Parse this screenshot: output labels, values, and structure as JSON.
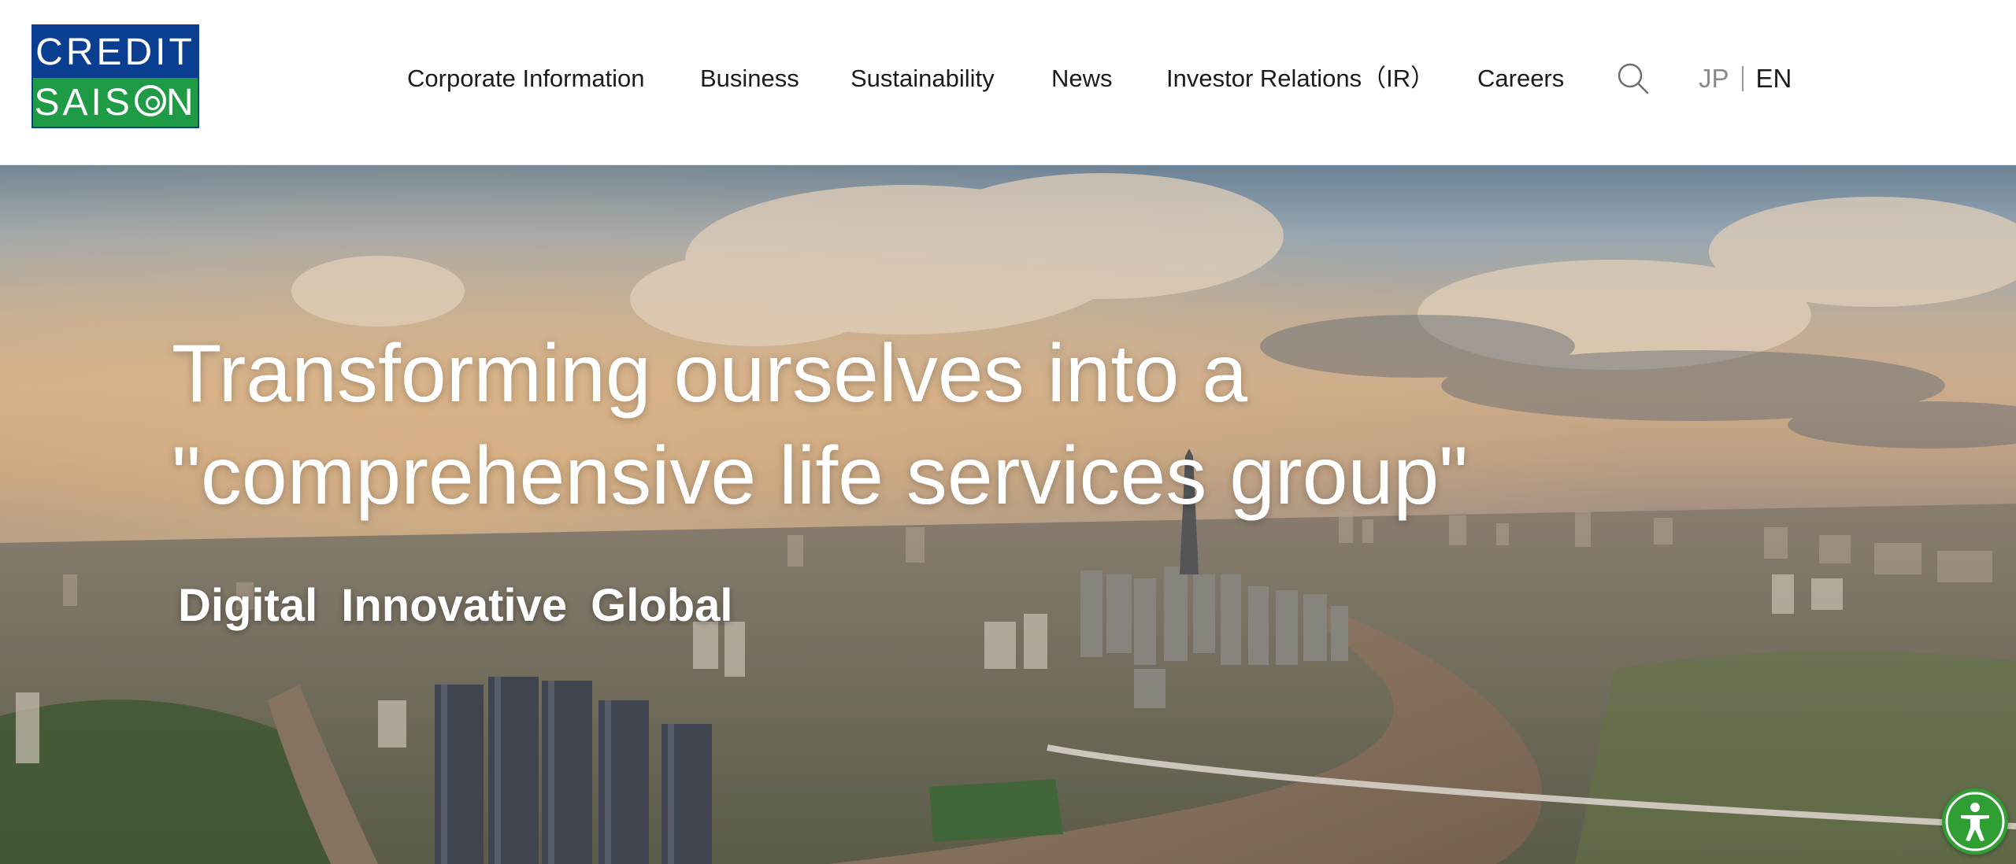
{
  "brand": {
    "logo_line1": "CREDIT",
    "logo_line2_prefix": "SAIS",
    "logo_line2_suffix": "N",
    "colors": {
      "logo_blue": "#0a3e90",
      "logo_green": "#1f9a45",
      "accessibility_green": "#2f9e33"
    }
  },
  "nav": {
    "items": [
      {
        "label": "Corporate Information"
      },
      {
        "label": "Business"
      },
      {
        "label": "Sustainability"
      },
      {
        "label": "News"
      },
      {
        "label": "Investor Relations（IR）"
      },
      {
        "label": "Careers"
      }
    ],
    "search_icon": "search-icon",
    "lang": {
      "jp": "JP",
      "en": "EN",
      "active": "EN"
    }
  },
  "hero": {
    "headline_line1": "Transforming ourselves into a",
    "headline_line2": "\"comprehensive life services group\"",
    "tags": [
      "Digital",
      "Innovative",
      "Global"
    ],
    "background": "aerial city skyline with river at sunset"
  },
  "accessibility": {
    "icon": "accessibility-icon"
  }
}
